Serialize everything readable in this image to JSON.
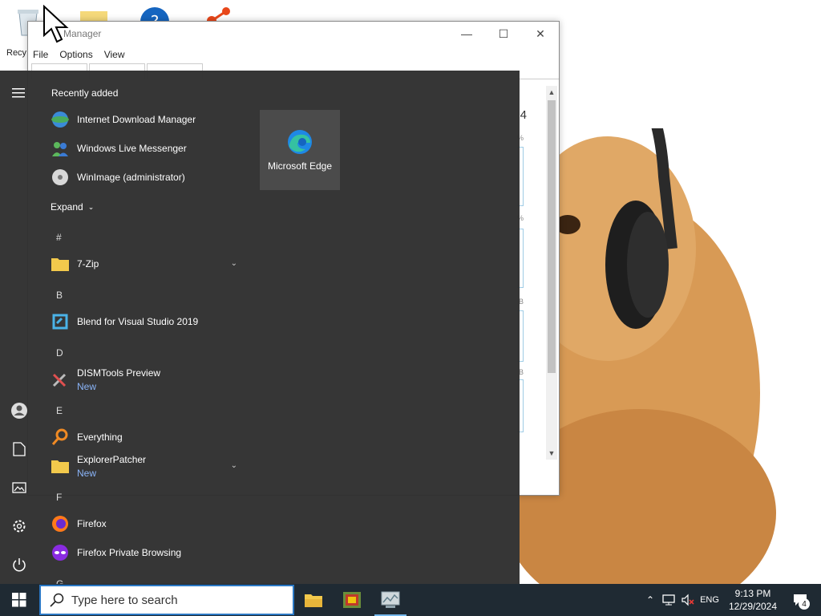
{
  "desktop": {
    "recycle_label": "Recy"
  },
  "task_manager": {
    "title": "Manager",
    "menu": [
      "File",
      "Options",
      "View"
    ],
    "perf_value": "4",
    "perf_pct": [
      "%",
      "%",
      "B",
      "B"
    ]
  },
  "start_menu": {
    "recently_added_title": "Recently added",
    "recent": [
      {
        "label": "Internet Download Manager",
        "icon": "idm-icon"
      },
      {
        "label": "Windows Live Messenger",
        "icon": "messenger-icon"
      },
      {
        "label": "WinImage (administrator)",
        "icon": "winimage-icon"
      }
    ],
    "expand_label": "Expand",
    "groups": [
      {
        "letter": "#",
        "apps": [
          {
            "label": "7-Zip",
            "sub": "",
            "icon": "folder-icon",
            "expandable": true
          }
        ]
      },
      {
        "letter": "B",
        "apps": [
          {
            "label": "Blend for Visual Studio 2019",
            "sub": "",
            "icon": "blend-icon",
            "expandable": false
          }
        ]
      },
      {
        "letter": "D",
        "apps": [
          {
            "label": "DISMTools Preview",
            "sub": "New",
            "icon": "tools-icon",
            "expandable": false
          }
        ]
      },
      {
        "letter": "E",
        "apps": [
          {
            "label": "Everything",
            "sub": "",
            "icon": "everything-search-icon",
            "expandable": false
          },
          {
            "label": "ExplorerPatcher",
            "sub": "New",
            "icon": "folder-icon",
            "expandable": true
          }
        ]
      },
      {
        "letter": "F",
        "apps": [
          {
            "label": "Firefox",
            "sub": "",
            "icon": "firefox-icon",
            "expandable": false
          },
          {
            "label": "Firefox Private Browsing",
            "sub": "",
            "icon": "firefox-private-icon",
            "expandable": false
          }
        ]
      },
      {
        "letter": "G",
        "apps": []
      }
    ],
    "tile": {
      "label": "Microsoft Edge",
      "icon": "edge-icon"
    }
  },
  "taskbar": {
    "search_placeholder": "Type here to search",
    "language": "ENG",
    "time": "9:13 PM",
    "date": "12/29/2024",
    "notification_count": "4"
  }
}
